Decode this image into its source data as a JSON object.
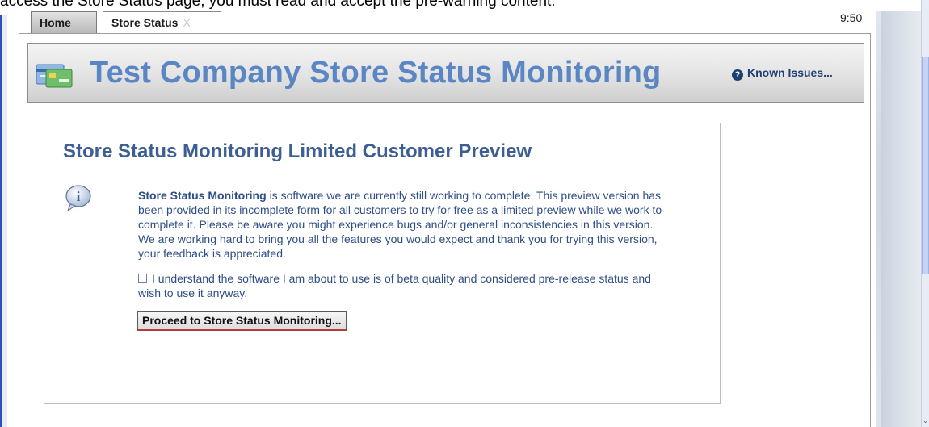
{
  "page_caption": "access the Store Status page, you must read and accept the pre-warning content.",
  "tabs": [
    {
      "label": "Home"
    },
    {
      "label": "Store Status",
      "close": "X"
    }
  ],
  "clock": "9:50",
  "header": {
    "title": "Test Company Store Status Monitoring",
    "known_issues": "Known Issues..."
  },
  "preview": {
    "title": "Store Status Monitoring Limited Customer Preview",
    "product_name": "Store Status Monitoring",
    "body": "is software we are currently still working to complete. This preview version has been provided in its incomplete form for all customers to try for free as a limited preview while we work to complete it. Please be aware you might experience bugs and/or general inconsistencies in this version. We are working hard to bring you all the features you would expect and thank you for trying this version, your feedback is appreciated.",
    "checkbox_label": "I understand the software I am about to use is of beta quality and considered pre-release status and wish to use it anyway.",
    "checkbox_checked": false,
    "proceed_button": "Proceed to Store Status Monitoring..."
  },
  "icons": [
    "app-card-icon",
    "question-icon",
    "info-bubble-icon",
    "checkbox"
  ],
  "colors": {
    "title_blue": "#5a86c4",
    "text_blue": "#2e4e86",
    "link_navy": "#1d3f73"
  }
}
